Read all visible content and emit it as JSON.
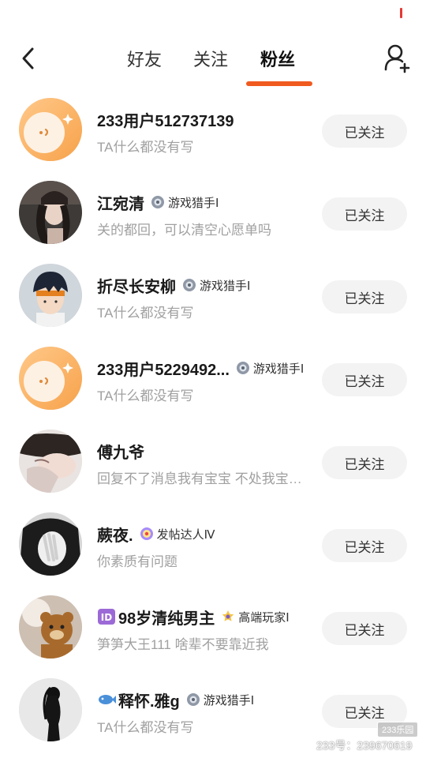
{
  "header": {
    "tabs": [
      {
        "label": "好友"
      },
      {
        "label": "关注"
      },
      {
        "label": "粉丝"
      }
    ],
    "active_tab": "粉丝"
  },
  "followers": [
    {
      "name": "233用户512737139",
      "badge": "",
      "desc": "TA什么都没有写",
      "button": "已关注"
    },
    {
      "name": "江宛清",
      "badge": "游戏猎手Ⅰ",
      "desc": "关的都回，可以清空心愿单吗",
      "button": "已关注"
    },
    {
      "name": "折尽长安柳",
      "badge": "游戏猎手Ⅰ",
      "desc": "TA什么都没有写",
      "button": "已关注"
    },
    {
      "name": "233用户5229492...",
      "badge": "游戏猎手Ⅰ",
      "desc": "TA什么都没有写",
      "button": "已关注"
    },
    {
      "name": "傅九爷",
      "badge": "",
      "desc": "回复不了消息我有宝宝 不处我宝…",
      "button": "已关注"
    },
    {
      "name": "蕨夜.",
      "badge": "发帖达人Ⅳ",
      "desc": "你素质有问题",
      "button": "已关注"
    },
    {
      "name": "98岁清纯男主",
      "badge": "高端玩家Ⅰ",
      "desc": "笋笋大王111 啥辈不要靠近我",
      "button": "已关注"
    },
    {
      "name": "释怀.雅g",
      "badge": "游戏猎手Ⅰ",
      "desc": "TA什么都没有写",
      "button": "已关注"
    }
  ],
  "watermark": {
    "badge": "233乐园",
    "text": "233号：239670619"
  },
  "colors": {
    "accent": "#f05a1e",
    "button_bg": "#f3f3f3",
    "desc_text": "#a0a0a0",
    "status_mark": "#e53935"
  },
  "icons": {
    "back": "chevron-left-icon",
    "add_friend": "add-user-icon",
    "badge": "medal-icon",
    "id_prefix": "id-icon",
    "fish_prefix": "fish-icon"
  }
}
